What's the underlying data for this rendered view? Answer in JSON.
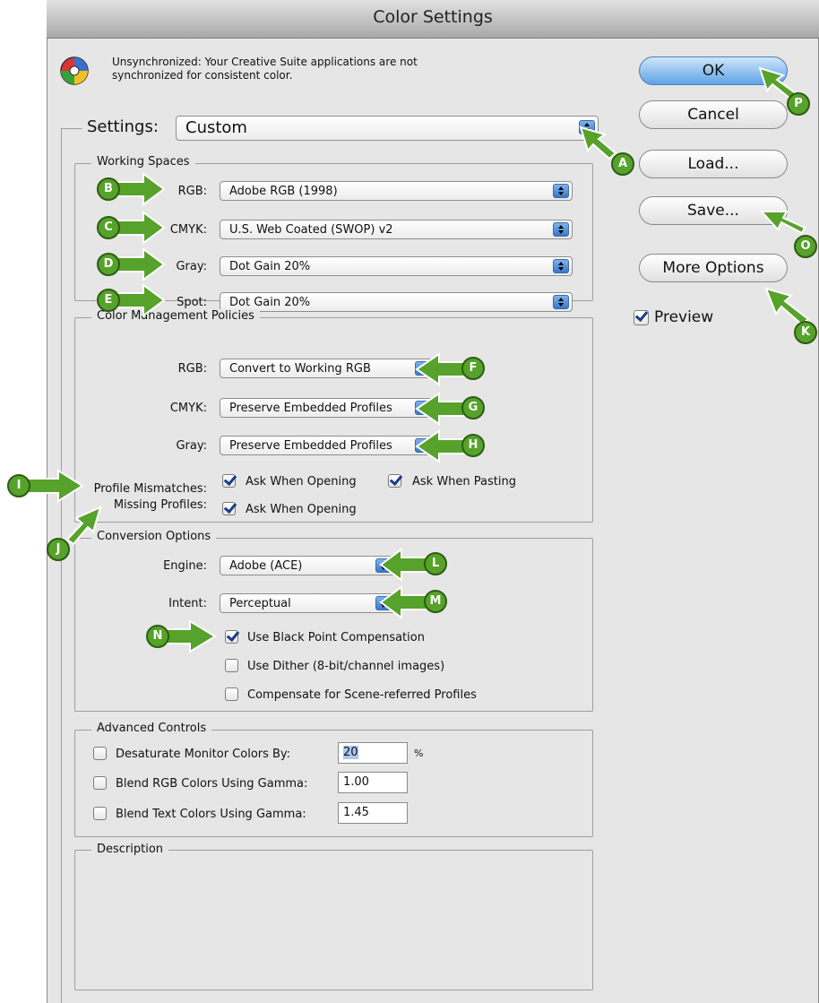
{
  "window": {
    "title": "Color Settings"
  },
  "sync_message": {
    "line1": "Unsynchronized: Your Creative Suite applications are not",
    "line2": "synchronized for consistent color."
  },
  "settings": {
    "label": "Settings:",
    "value": "Custom"
  },
  "working_spaces": {
    "legend": "Working Spaces",
    "rgb": {
      "label": "RGB:",
      "value": "Adobe RGB (1998)"
    },
    "cmyk": {
      "label": "CMYK:",
      "value": "U.S. Web Coated (SWOP) v2"
    },
    "gray": {
      "label": "Gray:",
      "value": "Dot Gain 20%"
    },
    "spot": {
      "label": "Spot:",
      "value": "Dot Gain 20%"
    }
  },
  "policies": {
    "legend": "Color Management Policies",
    "rgb": {
      "label": "RGB:",
      "value": "Convert to Working RGB"
    },
    "cmyk": {
      "label": "CMYK:",
      "value": "Preserve Embedded Profiles"
    },
    "gray": {
      "label": "Gray:",
      "value": "Preserve Embedded Profiles"
    },
    "profile_mismatches": {
      "label": "Profile Mismatches:",
      "ask_opening": "Ask When Opening",
      "ask_pasting": "Ask When Pasting",
      "ask_opening_checked": true,
      "ask_pasting_checked": true
    },
    "missing_profiles": {
      "label": "Missing Profiles:",
      "ask_opening": "Ask When Opening",
      "ask_opening_checked": true
    }
  },
  "conversion": {
    "legend": "Conversion Options",
    "engine": {
      "label": "Engine:",
      "value": "Adobe (ACE)"
    },
    "intent": {
      "label": "Intent:",
      "value": "Perceptual"
    },
    "black_point": {
      "label": "Use Black Point Compensation",
      "checked": true
    },
    "dither": {
      "label": "Use Dither (8-bit/channel images)",
      "checked": false
    },
    "scene_referred": {
      "label": "Compensate for Scene-referred Profiles",
      "checked": false
    }
  },
  "advanced": {
    "legend": "Advanced Controls",
    "desaturate": {
      "label": "Desaturate Monitor Colors By:",
      "value": "20",
      "unit": "%",
      "checked": false
    },
    "blend_rgb": {
      "label": "Blend RGB Colors Using Gamma:",
      "value": "1.00",
      "checked": false
    },
    "blend_text": {
      "label": "Blend Text Colors Using Gamma:",
      "value": "1.45",
      "checked": false
    }
  },
  "description": {
    "legend": "Description"
  },
  "buttons": {
    "ok": "OK",
    "cancel": "Cancel",
    "load": "Load...",
    "save": "Save...",
    "more_options": "More Options"
  },
  "preview": {
    "label": "Preview",
    "checked": true
  },
  "annotations": [
    "A",
    "B",
    "C",
    "D",
    "E",
    "F",
    "G",
    "H",
    "I",
    "J",
    "K",
    "L",
    "M",
    "N",
    "O",
    "P"
  ],
  "colors": {
    "arrow_green": "#56a22a",
    "select_arrow_blue": "#3a78c9",
    "ok_button_blue": "#5ea3e6"
  }
}
